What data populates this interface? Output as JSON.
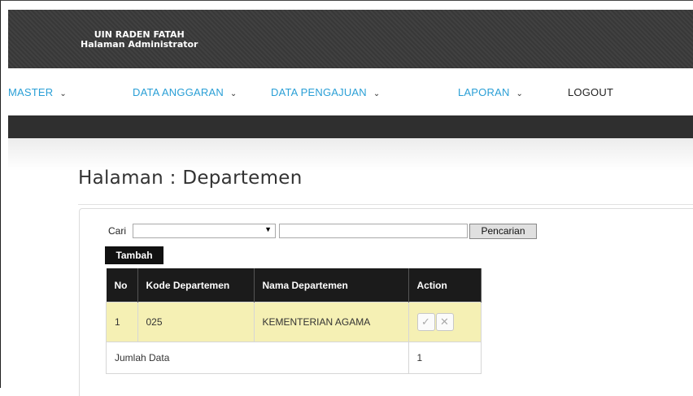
{
  "header": {
    "brand_line1": "UIN RADEN FATAH",
    "brand_line2": "Halaman Administrator"
  },
  "nav": {
    "items": [
      {
        "label": "MASTER",
        "has_dropdown": true
      },
      {
        "label": "DATA ANGGARAN",
        "has_dropdown": true
      },
      {
        "label": "DATA PENGAJUAN",
        "has_dropdown": true
      },
      {
        "label": "LAPORAN",
        "has_dropdown": true
      },
      {
        "label": "LOGOUT",
        "has_dropdown": false
      }
    ],
    "dropdown_glyph": "⌄"
  },
  "page": {
    "title": "Halaman : Departemen"
  },
  "search": {
    "label": "Cari",
    "select_value": "",
    "select_arrow": "▼",
    "input_value": "",
    "button_label": "Pencarian"
  },
  "actions": {
    "add_label": "Tambah"
  },
  "table": {
    "headers": [
      "No",
      "Kode Departemen",
      "Nama Departemen",
      "Action"
    ],
    "rows": [
      {
        "no": "1",
        "kode": "025",
        "nama": "KEMENTERIAN AGAMA"
      }
    ],
    "total_label": "Jumlah Data",
    "total_value": "1",
    "action_icons": {
      "approve": "check-icon",
      "delete": "close-icon"
    },
    "approve_glyph": "✓",
    "delete_glyph": "✕"
  },
  "colors": {
    "header_bg": "#3a3a3a",
    "nav_link": "#2a9fd6",
    "row_highlight": "#f5f0b4",
    "table_header_bg": "#1b1b1b"
  }
}
